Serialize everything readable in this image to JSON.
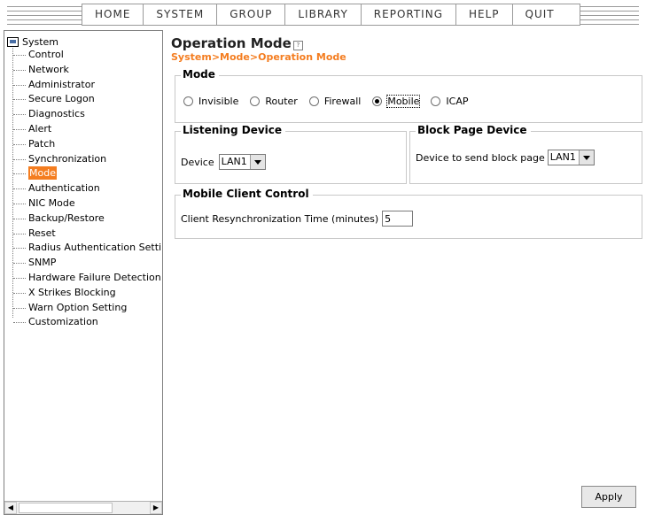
{
  "menu": {
    "items": [
      "HOME",
      "SYSTEM",
      "GROUP",
      "LIBRARY",
      "REPORTING",
      "HELP",
      "QUIT"
    ]
  },
  "sidebar": {
    "root_label": "System",
    "items": [
      "Control",
      "Network",
      "Administrator",
      "Secure Logon",
      "Diagnostics",
      "Alert",
      "Patch",
      "Synchronization",
      "Mode",
      "Authentication",
      "NIC Mode",
      "Backup/Restore",
      "Reset",
      "Radius Authentication Setting",
      "SNMP",
      "Hardware Failure Detection",
      "X Strikes Blocking",
      "Warn Option Setting",
      "Customization"
    ],
    "selected": "Mode"
  },
  "page": {
    "title": "Operation Mode",
    "breadcrumb": "System>Mode>Operation Mode"
  },
  "mode": {
    "legend": "Mode",
    "options": [
      "Invisible",
      "Router",
      "Firewall",
      "Mobile",
      "ICAP"
    ],
    "selected": "Mobile"
  },
  "listening": {
    "legend": "Listening Device",
    "label": "Device",
    "value": "LAN1"
  },
  "block_page": {
    "legend": "Block Page Device",
    "label": "Device to send block page",
    "value": "LAN1"
  },
  "mobile_control": {
    "legend": "Mobile Client Control",
    "label": "Client Resynchronization Time (minutes)",
    "value": "5"
  },
  "actions": {
    "apply_label": "Apply"
  },
  "colors": {
    "accent": "#f47d20",
    "border": "#c8c8c8"
  },
  "icons": {
    "root": "computer-icon",
    "help": "help-icon",
    "select": "chevron-down-icon"
  }
}
